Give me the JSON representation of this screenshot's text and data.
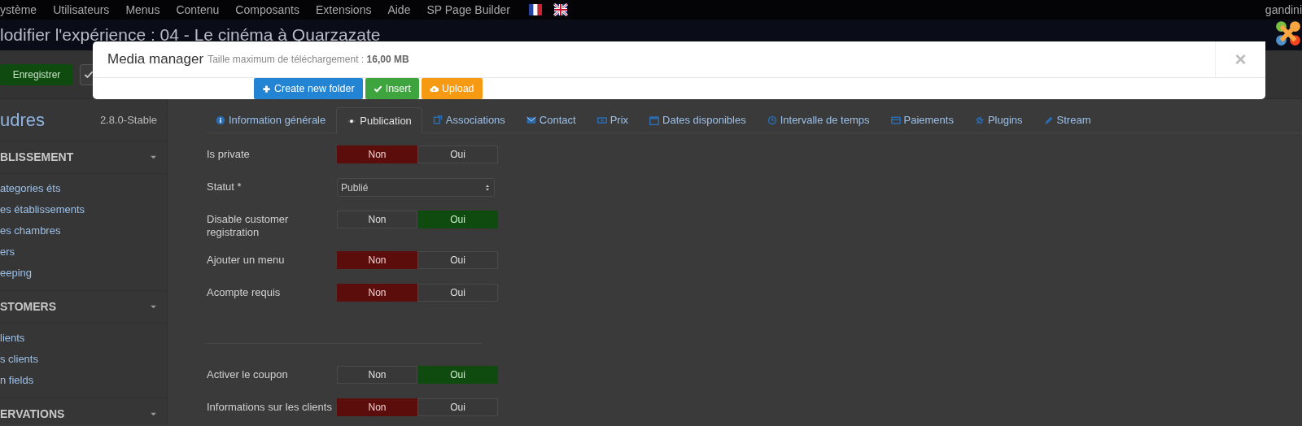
{
  "top_menu": {
    "items": [
      "ystème",
      "Utilisateurs",
      "Menus",
      "Contenu",
      "Composants",
      "Extensions",
      "Aide",
      "SP Page Builder"
    ],
    "user": "gandini"
  },
  "page_title": "lodifier l'expérience : 04 - Le cinéma à Quarzazate",
  "toolbar": {
    "save": "Enregistrer"
  },
  "sidebar": {
    "brand": "udres",
    "version": "2.8.0-Stable",
    "sections": [
      {
        "title": "BLISSEMENT",
        "items": [
          "ategories éts",
          "es établissements",
          "es chambres",
          "ers",
          "eeping"
        ]
      },
      {
        "title": "STOMERS",
        "items": [
          "lients",
          "s clients",
          "n fields"
        ]
      },
      {
        "title": "ERVATIONS"
      }
    ]
  },
  "tabs": [
    {
      "label": "Information générale",
      "selected": false
    },
    {
      "label": "Publication",
      "selected": true
    },
    {
      "label": "Associations",
      "selected": false
    },
    {
      "label": "Contact",
      "selected": false
    },
    {
      "label": "Prix",
      "selected": false
    },
    {
      "label": "Dates disponibles",
      "selected": false
    },
    {
      "label": "Intervalle de temps",
      "selected": false
    },
    {
      "label": "Paiements",
      "selected": false
    },
    {
      "label": "Plugins",
      "selected": false
    },
    {
      "label": "Stream",
      "selected": false
    }
  ],
  "form": [
    {
      "kind": "toggle",
      "label": "Is private",
      "options": [
        {
          "label": "Non",
          "selected": true
        },
        {
          "label": "Oui",
          "selected": false
        }
      ]
    },
    {
      "kind": "select",
      "label": "Statut *",
      "value": "Publié"
    },
    {
      "kind": "toggle",
      "label": "Disable customer registration",
      "options": [
        {
          "label": "Non",
          "selected": false
        },
        {
          "label": "Oui",
          "selected": true
        }
      ]
    },
    {
      "kind": "toggle",
      "label": "Ajouter un menu",
      "options": [
        {
          "label": "Non",
          "selected": true
        },
        {
          "label": "Oui",
          "selected": false
        }
      ]
    },
    {
      "kind": "toggle",
      "label": "Acompte requis",
      "options": [
        {
          "label": "Non",
          "selected": true
        },
        {
          "label": "Oui",
          "selected": false
        }
      ]
    },
    {
      "kind": "divider"
    },
    {
      "kind": "toggle",
      "label": "Activer le coupon",
      "options": [
        {
          "label": "Non",
          "selected": false
        },
        {
          "label": "Oui",
          "selected": true
        }
      ]
    },
    {
      "kind": "toggle",
      "label": "Informations sur les clients",
      "options": [
        {
          "label": "Non",
          "selected": true
        },
        {
          "label": "Oui",
          "selected": false
        }
      ]
    }
  ],
  "modal": {
    "title": "Media manager",
    "subtitle": "Taille maximum de téléchargement : **16,00 MB**",
    "close": "×",
    "buttons": [
      {
        "label": "Create new folder",
        "kind": "primary"
      },
      {
        "label": "Insert",
        "kind": "success"
      },
      {
        "label": "Upload",
        "kind": "warning"
      }
    ]
  }
}
